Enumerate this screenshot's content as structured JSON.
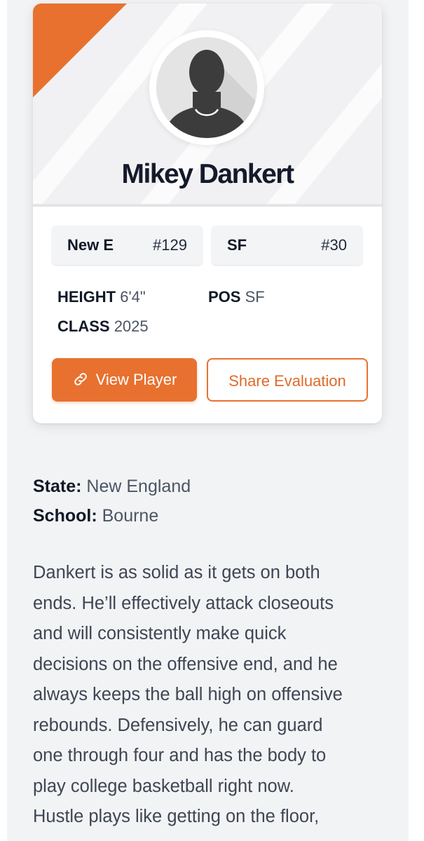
{
  "player": {
    "name": "Mikey Dankert"
  },
  "rankings": {
    "team": {
      "label": "New E",
      "rank": "#129"
    },
    "position": {
      "label": "SF",
      "rank": "#30"
    }
  },
  "attributes": {
    "height": {
      "label": "HEIGHT",
      "value": "6'4\""
    },
    "pos": {
      "label": "POS",
      "value": "SF"
    },
    "class": {
      "label": "CLASS",
      "value": "2025"
    }
  },
  "buttons": {
    "view_player": "View Player",
    "share_evaluation": "Share Evaluation"
  },
  "info": {
    "state_label": "State:",
    "state_value": "New England",
    "school_label": "School:",
    "school_value": "Bourne"
  },
  "bio": {
    "lines": [
      "Dankert is as solid as it gets on both",
      "ends. He’ll effectively attack closeouts",
      "and will consistently make quick",
      "decisions on the offensive end, and he",
      "always keeps the ball high on offensive",
      "rebounds. Defensively, he can guard",
      "one through four and has the body to",
      "play college basketball right now.",
      "Hustle plays like getting on the floor,"
    ]
  },
  "colors": {
    "accent": "#e8712f",
    "name": "#141a2a",
    "page_bg": "#f2f3f5"
  },
  "icons": {
    "avatar": "silhouette-avatar-icon",
    "view_player": "link-icon"
  }
}
